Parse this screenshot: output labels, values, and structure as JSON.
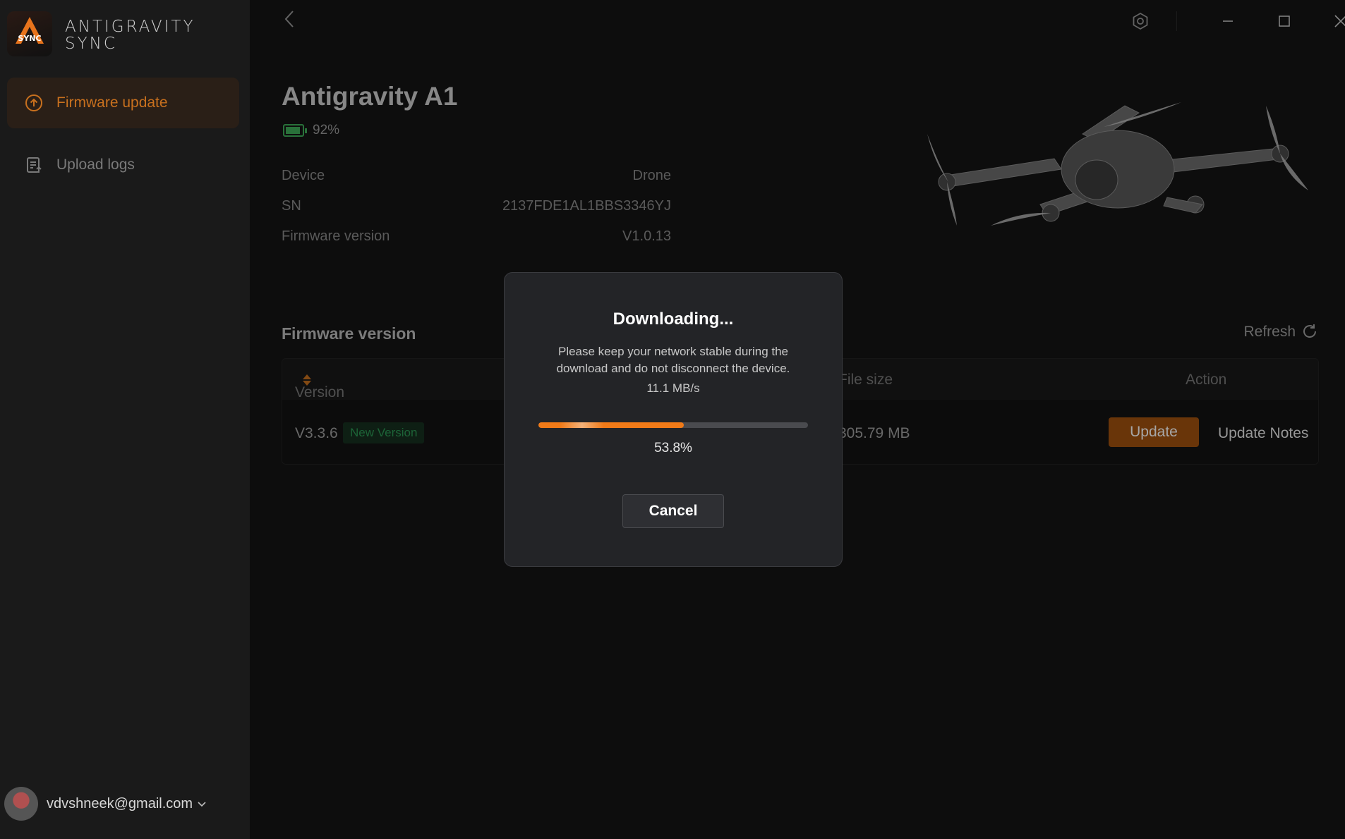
{
  "app": {
    "brand_line1": "ANTIGRAVITY",
    "brand_line2": "SYNC",
    "logo_text": "SYNC"
  },
  "sidebar": {
    "items": [
      {
        "label": "Firmware update",
        "icon": "upload-circle-icon",
        "active": true
      },
      {
        "label": "Upload logs",
        "icon": "log-document-icon",
        "active": false
      }
    ],
    "user_email": "vdvshneek@gmail.com"
  },
  "device": {
    "name": "Antigravity A1",
    "battery": "92%",
    "battery_level": 0.92,
    "rows": [
      {
        "label": "Device",
        "value": "Drone"
      },
      {
        "label": "SN",
        "value": "2137FDE1AL1BBS3346YJ"
      },
      {
        "label": "Firmware version",
        "value": "V1.0.13"
      }
    ]
  },
  "firmware": {
    "title": "Firmware version",
    "refresh_label": "Refresh",
    "columns": {
      "version": "Version number",
      "size": "File size",
      "action": "Action"
    },
    "row": {
      "version": "V3.3.6",
      "badge": "New Version",
      "size": "305.79 MB",
      "update_label": "Update",
      "notes_label": "Update Notes"
    }
  },
  "modal": {
    "title": "Downloading...",
    "message": "Please keep your network stable during the download and do not disconnect the device.",
    "speed": "11.1 MB/s",
    "progress": 0.538,
    "progress_label": "53.8%",
    "cancel_label": "Cancel"
  },
  "colors": {
    "accent": "#f07a18",
    "badge_green": "#2c9a55",
    "battery_green": "#3fae5a"
  }
}
